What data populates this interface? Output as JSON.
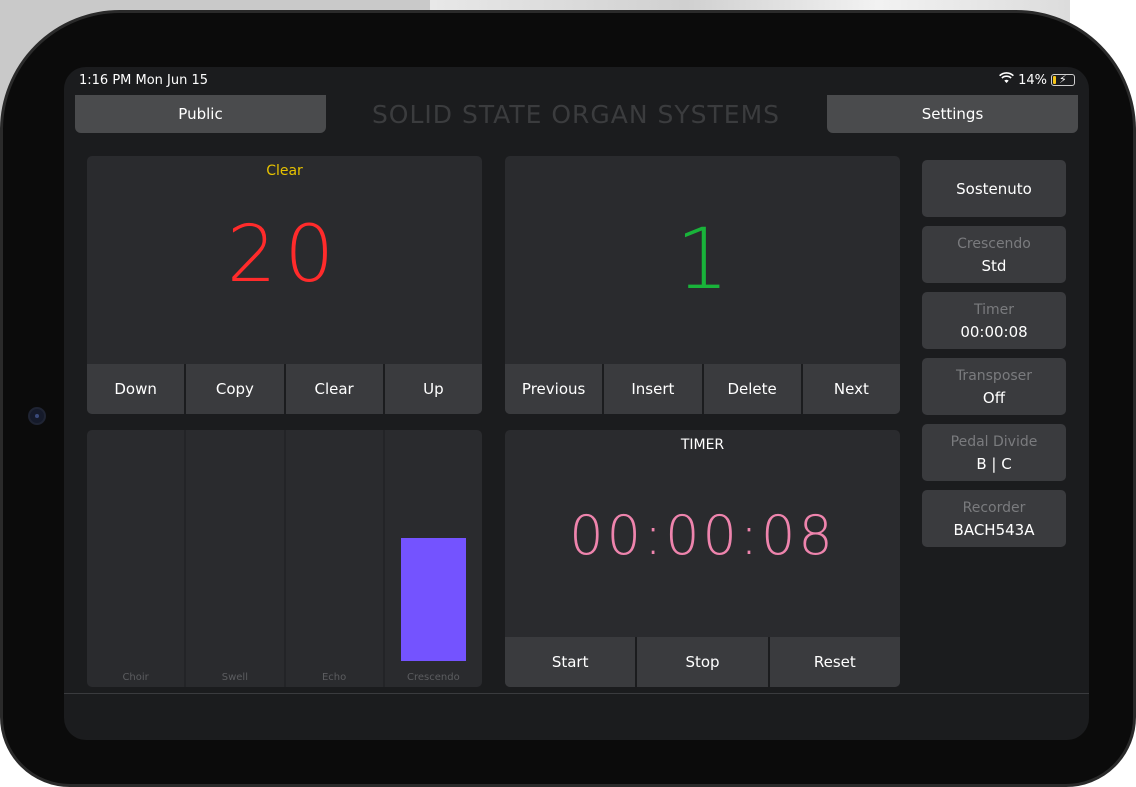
{
  "status_bar": {
    "time": "1:16 PM  Mon Jun 15",
    "wifi_icon": "wifi-icon",
    "battery_percent": "14%",
    "battery_level": 0.14
  },
  "header": {
    "public_label": "Public",
    "title": "SOLID STATE ORGAN SYSTEMS",
    "settings_label": "Settings"
  },
  "memory_panel": {
    "caption": "Clear",
    "value": "20",
    "value_color": "#ff2b2b",
    "caption_color": "#e6c200",
    "buttons": [
      "Down",
      "Copy",
      "Clear",
      "Up"
    ]
  },
  "sequence_panel": {
    "value": "1",
    "value_color": "#19b33a",
    "buttons": [
      "Previous",
      "Insert",
      "Delete",
      "Next"
    ]
  },
  "expression_panel": {
    "bars": [
      {
        "label": "Choir",
        "level": 0
      },
      {
        "label": "Swell",
        "level": 0
      },
      {
        "label": "Echo",
        "level": 0
      },
      {
        "label": "Crescendo",
        "level": 0.55
      }
    ],
    "bar_color": "#7453ff"
  },
  "timer_panel": {
    "caption": "TIMER",
    "value": "00:00:08",
    "value_color": "#ee84ad",
    "buttons": [
      "Start",
      "Stop",
      "Reset"
    ]
  },
  "side_buttons": {
    "sostenuto": "Sostenuto",
    "crescendo_label": "Crescendo",
    "crescendo_value": "Std",
    "timer_label": "Timer",
    "timer_value": "00:00:08",
    "transposer_label": "Transposer",
    "transposer_value": "Off",
    "pedal_divide_label": "Pedal Divide",
    "pedal_divide_value": "B | C",
    "recorder_label": "Recorder",
    "recorder_value": "BACH543A"
  }
}
